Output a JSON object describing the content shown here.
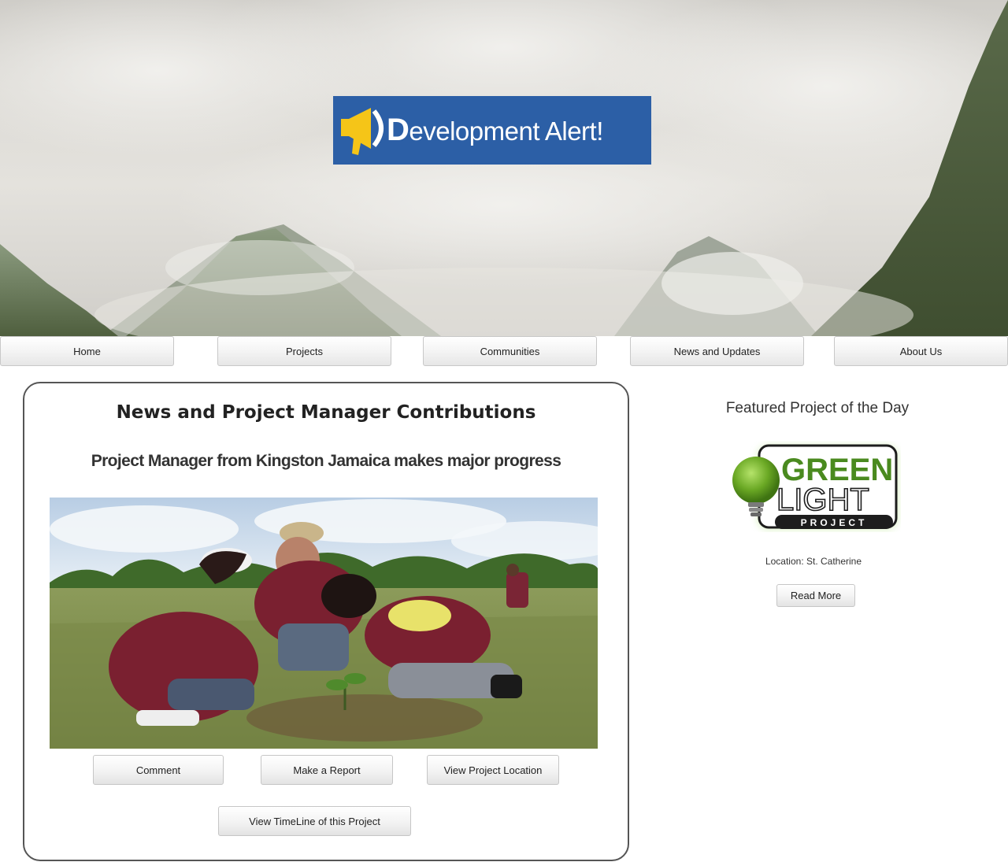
{
  "brand": {
    "logo_text": "evelopment Alert!",
    "logo_initial": "D",
    "logo_bg": "#2c5fa6",
    "logo_accent": "#f5c518"
  },
  "nav": {
    "items": [
      {
        "label": "Home"
      },
      {
        "label": "Projects"
      },
      {
        "label": "Communities"
      },
      {
        "label": "News and Updates"
      },
      {
        "label": "About Us"
      }
    ]
  },
  "main": {
    "title": "News and Project Manager Contributions",
    "subtitle": "Project Manager from Kingston Jamaica makes major progress",
    "buttons": {
      "comment": "Comment",
      "report": "Make a Report",
      "location": "View Project Location",
      "timeline": "View TimeLine of this Project"
    }
  },
  "sidebar": {
    "title": "Featured Project of the Day",
    "logo": {
      "line1": "GREEN",
      "line2": "LIGHT",
      "line3": "PROJECT",
      "color": "#4a8a1f"
    },
    "location": "Location: St. Catherine",
    "read_more": "Read More"
  }
}
